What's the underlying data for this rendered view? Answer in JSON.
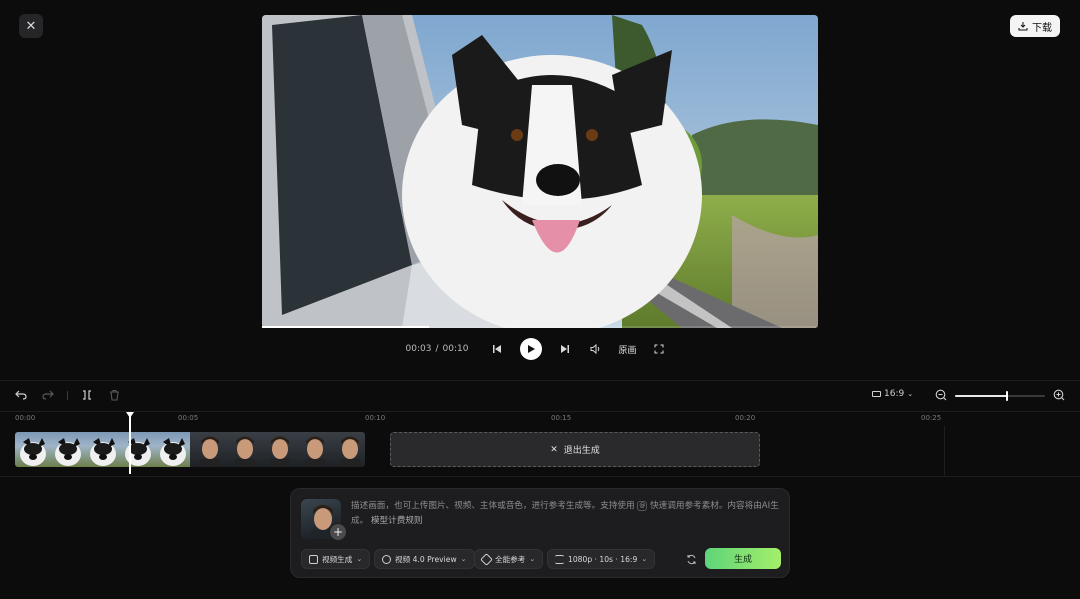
{
  "top": {
    "download_label": "下载"
  },
  "player": {
    "current_time": "00:03",
    "separator": "/",
    "total_time": "00:10",
    "original_label": "原画",
    "progress": 0.3
  },
  "toolbar": {
    "ratio": "16:9",
    "zoom_level": 0.58
  },
  "ruler": {
    "ticks": [
      "00:00",
      "00:05",
      "00:10",
      "00:15",
      "00:20",
      "00:25"
    ]
  },
  "timeline": {
    "generate_out_label": "退出生成"
  },
  "prompt": {
    "text_part1": "描述画面，也可上传图片、视频、主体或音色，进行参考生成等。支持使用",
    "text_part2": "快速调用参考素材。内容将由AI生成。",
    "rules_link": "模型计费规则",
    "options": [
      {
        "label": "视频生成",
        "icon": "video-gen-icon"
      },
      {
        "label": "视频 4.0 Preview",
        "icon": "model-icon"
      },
      {
        "label": "全能参考",
        "icon": "reference-icon"
      },
      {
        "label": "1080p · 10s · 16:9",
        "icon": "settings-icon"
      }
    ],
    "generate_label": "生成"
  },
  "colors": {
    "accent_green": "#7ee26e",
    "background": "#0c0c0d"
  }
}
